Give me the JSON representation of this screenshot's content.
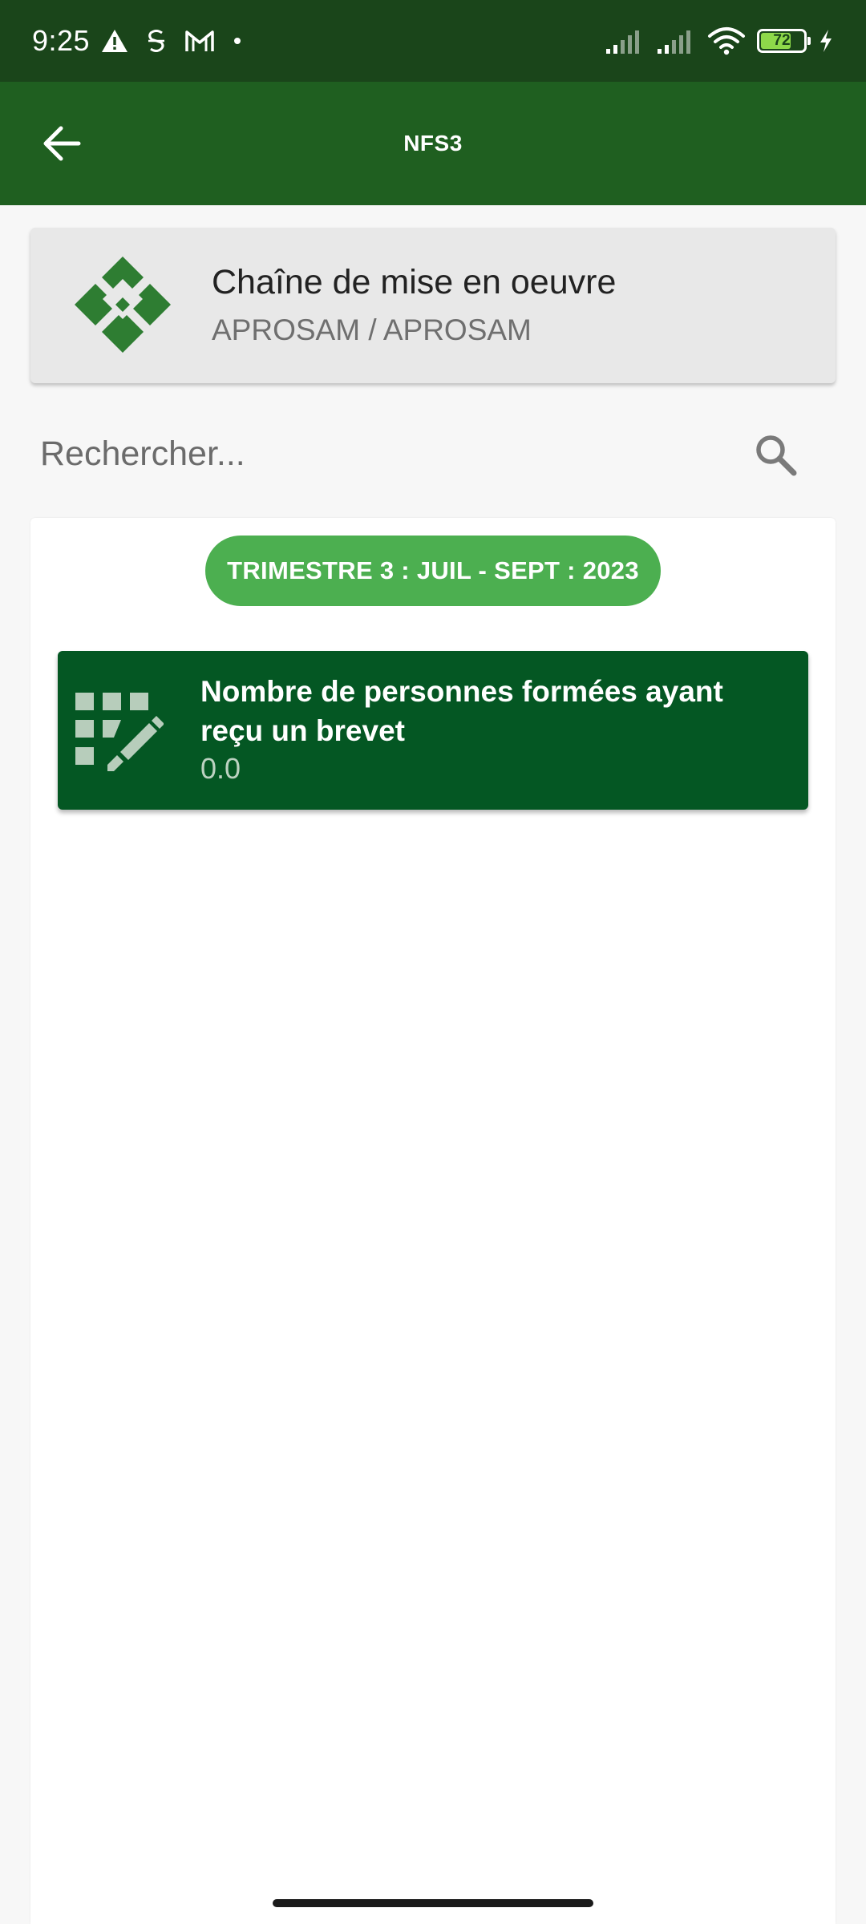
{
  "status_bar": {
    "time": "9:25",
    "icons_left": [
      "alert-icon",
      "notification-s-icon",
      "gmail-icon",
      "dot-icon"
    ],
    "icons_right": [
      "signal-icon",
      "signal-icon",
      "wifi-icon",
      "battery-icon",
      "charging-icon"
    ],
    "battery_level": "72",
    "battery_fraction": 0.72
  },
  "app_bar": {
    "title": "NFS3",
    "back_icon": "arrow-left-icon",
    "background": "#1f5f20"
  },
  "header_card": {
    "title": "Chaîne de mise en oeuvre",
    "subtitle": "APROSAM / APROSAM",
    "logo_icon": "diamond-cluster-icon"
  },
  "search": {
    "placeholder": "Rechercher...",
    "value": ""
  },
  "period": {
    "label": "TRIMESTRE 3 : JUIL - SEPT : 2023",
    "color": "#4caf50"
  },
  "indicators": [
    {
      "title": "Nombre de personnes formées ayant reçu un brevet",
      "value": "0.0",
      "icon": "grid-edit-icon",
      "color": "#045723"
    }
  ]
}
